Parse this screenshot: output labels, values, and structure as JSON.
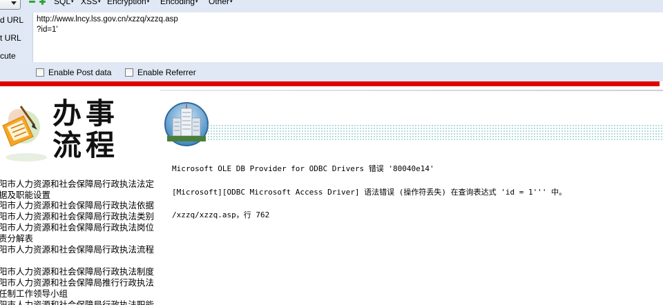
{
  "hackbar": {
    "menu": [
      {
        "label": "SQL",
        "arrow": "▾"
      },
      {
        "label": "XSS",
        "arrow": "▾"
      },
      {
        "label": "Encryption",
        "arrow": "▾"
      },
      {
        "label": "Encoding",
        "arrow": "▾"
      },
      {
        "label": "Other",
        "arrow": "▾"
      }
    ],
    "side_buttons": {
      "load_url": "d URL",
      "split_url": "t URL",
      "execute": "cute"
    },
    "url_lines": [
      "http://www.lncy.lss.gov.cn/xzzq/xzzq.asp",
      "?id=1'"
    ],
    "enable_post_label": "Enable Post data",
    "enable_referrer_label": "Enable Referrer",
    "accent_color": "#e10000"
  },
  "page": {
    "title_line1": "办事",
    "title_line2": "流程",
    "left_lines": [
      "阳市人力资源和社会保障局行政执法法定",
      "据及职能设置",
      "阳市人力资源和社会保障局行政执法依据",
      "阳市人力资源和社会保障局行政执法类别",
      "阳市人力资源和社会保障局行政执法岗位",
      "责分解表",
      "阳市人力资源和社会保障局行政执法流程",
      "",
      "阳市人力资源和社会保障局行政执法制度",
      "阳市人力资源和社会保障局推行行政执法",
      "任制工作领导小组",
      "阳市人力资源和社会保障局行政执法职能"
    ],
    "error_lines": [
      "Microsoft OLE DB Provider for ODBC Drivers 错误 '80040e14'",
      "[Microsoft][ODBC Microsoft Access Driver] 语法错误 (操作符丢失) 在查询表达式 'id = 1''' 中。",
      "/xzzq/xzzq.asp，行 762"
    ]
  },
  "icons": [
    "chevron-down-icon",
    "minus-icon",
    "plus-icon",
    "flow-document-icon",
    "building-badge-icon"
  ]
}
